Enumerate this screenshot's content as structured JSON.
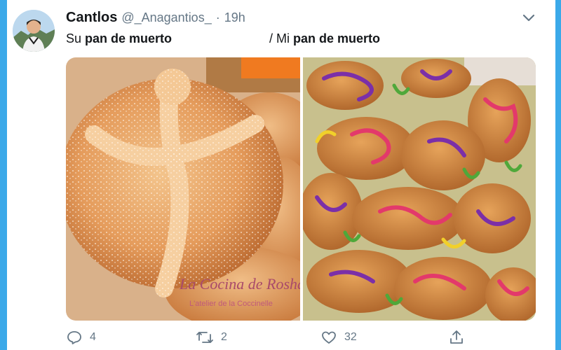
{
  "tweet": {
    "display_name": "Cantlos",
    "handle": "@_Anagantios_",
    "separator": "·",
    "time": "19h",
    "text_part1_prefix": "Su ",
    "text_part1_bold": "pan de muerto",
    "text_part2_prefix": "/ Mi ",
    "text_part2_bold": "pan de muerto",
    "watermark_title": "La Cocina de Rosha",
    "watermark_subtitle": "L'atelier de la Coccinelle"
  },
  "actions": {
    "reply_count": "4",
    "retweet_count": "2",
    "like_count": "32"
  },
  "icons": {
    "more": "chevron-down-icon",
    "reply": "reply-icon",
    "retweet": "retweet-icon",
    "like": "heart-icon",
    "share": "share-icon"
  },
  "colors": {
    "frame": "#3ba9e9",
    "text": "#14171a",
    "secondary_text": "#657786"
  }
}
